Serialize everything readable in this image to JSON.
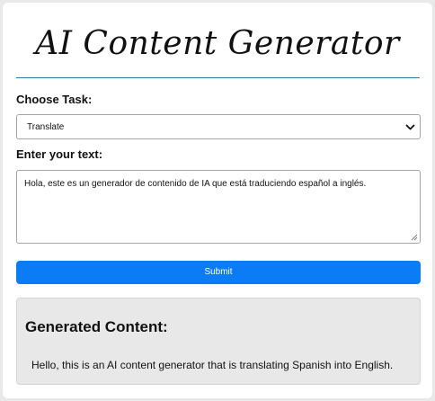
{
  "app": {
    "title": "AI Content Generator"
  },
  "form": {
    "task_label": "Choose Task:",
    "task_selected": "Translate",
    "text_label": "Enter your text:",
    "text_value": "Hola, este es un generador de contenido de IA que está traduciendo español a inglés.",
    "submit_label": "Submit"
  },
  "result": {
    "heading": "Generated Content:",
    "text": "Hello, this is an AI content generator that is translating Spanish into English."
  },
  "colors": {
    "accent": "#0b7cf6",
    "title_rule": "#2b7fae",
    "result_bg": "#e8e8e8",
    "page_bg": "#e9e9e9"
  },
  "icons": {
    "select_arrow": "chevron-down-icon",
    "resize": "resize-handle-icon"
  }
}
